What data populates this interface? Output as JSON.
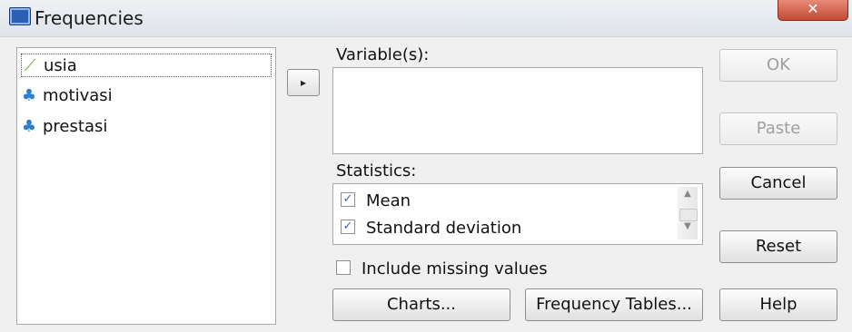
{
  "window": {
    "title": "Frequencies",
    "close_glyph": "✕"
  },
  "source_list": {
    "items": [
      {
        "label": "usia",
        "icon": "ruler-icon"
      },
      {
        "label": "motivasi",
        "icon": "scale-icon"
      },
      {
        "label": "prestasi",
        "icon": "scale-icon"
      }
    ]
  },
  "move_button": {
    "glyph": "▸"
  },
  "variables": {
    "label": "Variable(s):"
  },
  "statistics": {
    "label": "Statistics:",
    "items": [
      {
        "label": "Mean",
        "checked": true
      },
      {
        "label": "Standard deviation",
        "checked": true
      }
    ]
  },
  "missing": {
    "label": "Include missing values",
    "checked": false
  },
  "buttons": {
    "ok": "OK",
    "paste": "Paste",
    "cancel": "Cancel",
    "reset": "Reset",
    "help": "Help",
    "charts": "Charts...",
    "frequency_tables": "Frequency Tables..."
  }
}
